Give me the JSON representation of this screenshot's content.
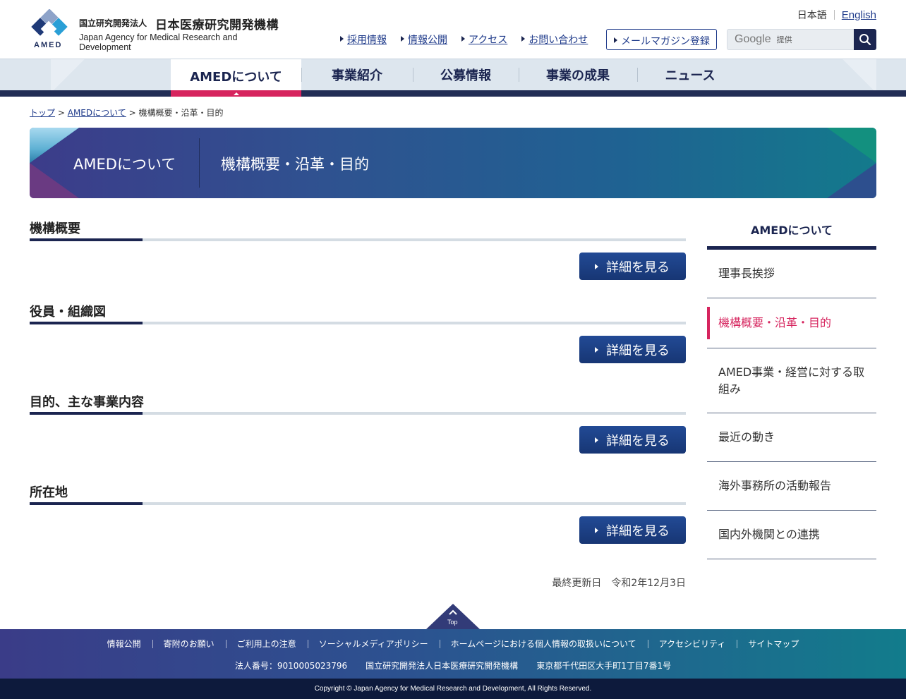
{
  "header": {
    "logo_mark_text": "AMED",
    "org_type": "国立研究開発法人",
    "org_name": "日本医療研究開発機構",
    "org_name_en": "Japan Agency for Medical Research and Development",
    "lang_ja": "日本語",
    "lang_en": "English",
    "utility_links": [
      "採用情報",
      "情報公開",
      "アクセス",
      "お問い合わせ"
    ],
    "mail_button": "メールマガジン登録",
    "search": {
      "brand": "Google",
      "provided": "提供"
    }
  },
  "nav": {
    "items": [
      "AMEDについて",
      "事業紹介",
      "公募情報",
      "事業の成果",
      "ニュース"
    ],
    "active_index": 0
  },
  "breadcrumb": {
    "top": "トップ",
    "section": "AMEDについて",
    "current": "機構概要・沿革・目的",
    "separator": ">"
  },
  "banner": {
    "section": "AMEDについて",
    "title": "機構概要・沿革・目的"
  },
  "main": {
    "sections": [
      {
        "heading": "機構概要",
        "button": "詳細を見る"
      },
      {
        "heading": "役員・組織図",
        "button": "詳細を見る"
      },
      {
        "heading": "目的、主な事業内容",
        "button": "詳細を見る"
      },
      {
        "heading": "所在地",
        "button": "詳細を見る"
      }
    ],
    "updated": "最終更新日　令和2年12月3日"
  },
  "sidebar": {
    "heading": "AMEDについて",
    "items": [
      {
        "label": "理事長挨拶"
      },
      {
        "label": "機構概要・沿革・目的"
      },
      {
        "label": "AMED事業・経営に対する取組み"
      },
      {
        "label": "最近の動き"
      },
      {
        "label": "海外事務所の活動報告"
      },
      {
        "label": "国内外機関との連携"
      }
    ],
    "current_index": 1
  },
  "footer": {
    "top_label": "Top",
    "links": [
      "情報公開",
      "寄附のお願い",
      "ご利用上の注意",
      "ソーシャルメディアポリシー",
      "ホームページにおける個人情報の取扱いについて",
      "アクセシビリティ",
      "サイトマップ"
    ],
    "corporate_number": "法人番号：9010005023796",
    "org_full": "国立研究開発法人日本医療研究開発機構",
    "address": "東京都千代田区大手町1丁目7番1号",
    "copyright": "Copyright © Japan Agency for Medical Research and Development, All Rights Reserved."
  },
  "colors": {
    "navy": "#1b2550",
    "accent_pink": "#d6245e",
    "link_blue": "#1e3a8a",
    "button_blue": "#1f4289"
  }
}
